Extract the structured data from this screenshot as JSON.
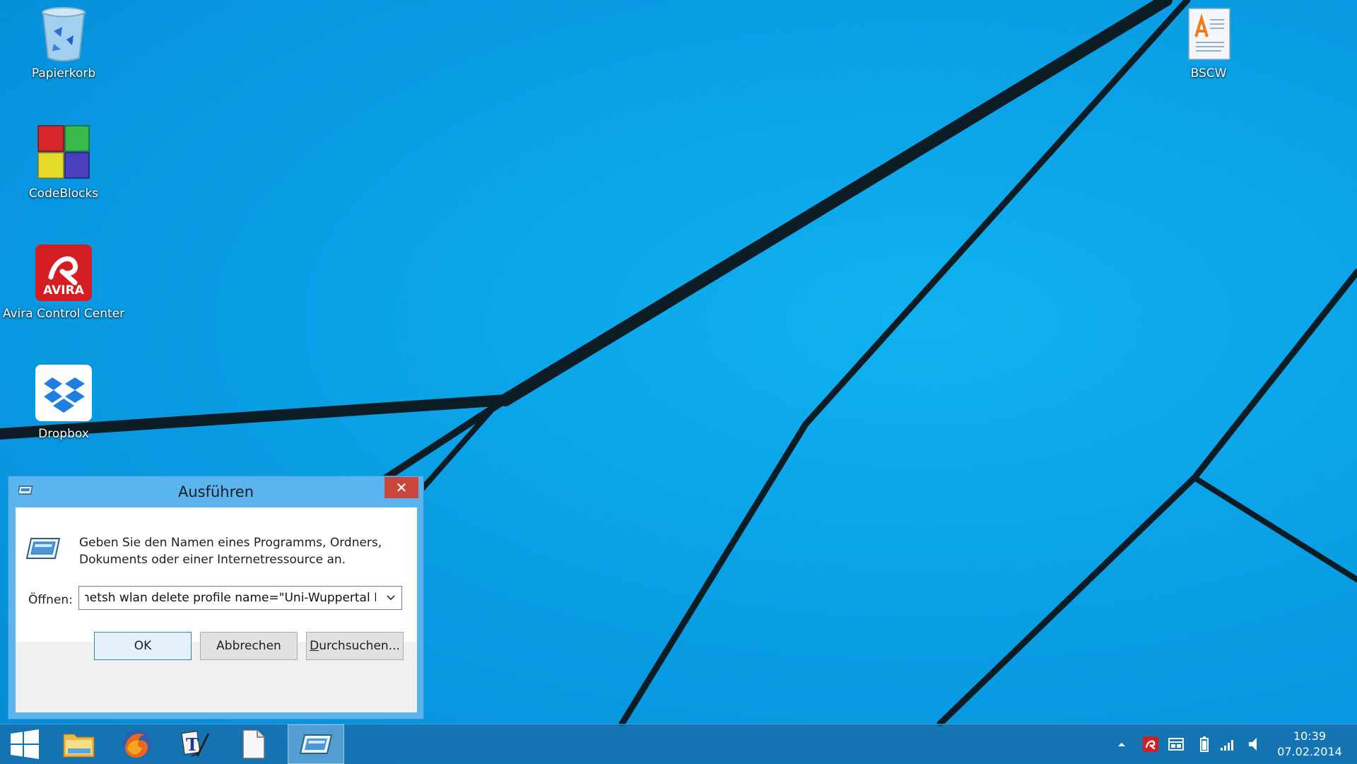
{
  "desktop": {
    "icons": [
      {
        "id": "recycle-bin",
        "label": "Papierkorb"
      },
      {
        "id": "codeblocks",
        "label": "CodeBlocks"
      },
      {
        "id": "avira",
        "label": "Avira Control Center",
        "logo_text": "AVIRA"
      },
      {
        "id": "dropbox",
        "label": "Dropbox"
      },
      {
        "id": "bscw",
        "label": "BSCW"
      }
    ]
  },
  "run_dialog": {
    "title": "Ausführen",
    "close_label": "✕",
    "description_line1": "Geben Sie den Namen eines Programms, Ordners,",
    "description_line2": "Dokuments oder einer Internetressource an.",
    "open_label": "Öffnen:",
    "open_value": "netsh wlan delete profile name=\"Uni-Wuppertal EAP\"",
    "ok_label": "OK",
    "cancel_label": "Abbrechen",
    "browse_label_underlined": "D",
    "browse_label_rest": "urchsuchen..."
  },
  "taskbar": {
    "items": [
      {
        "id": "start",
        "icon": "windows-logo-icon"
      },
      {
        "id": "file-explorer",
        "icon": "folder-icon"
      },
      {
        "id": "firefox",
        "icon": "firefox-icon"
      },
      {
        "id": "texmaker",
        "icon": "tex-editor-icon"
      },
      {
        "id": "blank-document",
        "icon": "document-icon"
      },
      {
        "id": "run",
        "icon": "run-icon",
        "active": true
      }
    ],
    "tray": [
      "show-hidden-icons",
      "avira-tray-icon",
      "network-adapter-icon",
      "battery-icon",
      "signal-icon",
      "volume-icon"
    ],
    "clock": {
      "time": "10:39",
      "date": "07.02.2014"
    }
  },
  "colors": {
    "desktop": "#0aa0e6",
    "dialog_frame": "#5ab4ee",
    "close_button": "#c9463d",
    "taskbar": "#1c6eaa",
    "avira_red": "#d51d24"
  }
}
